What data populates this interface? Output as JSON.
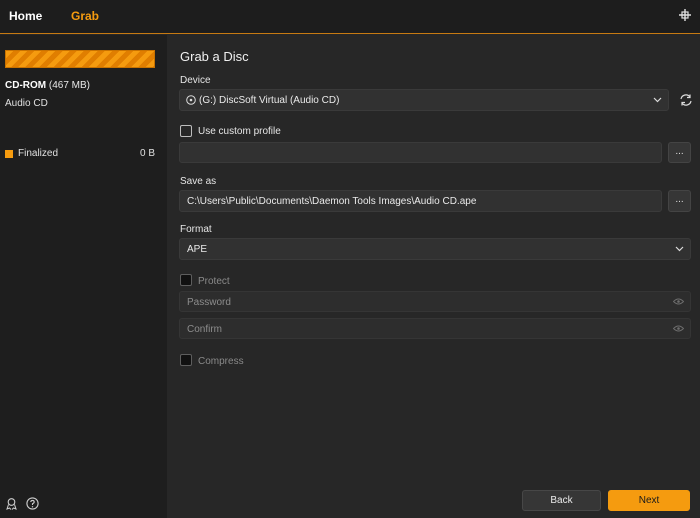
{
  "tabs": [
    {
      "label": "Home"
    },
    {
      "label": "Grab"
    }
  ],
  "sidebar": {
    "disc_name": "CD-ROM",
    "disc_size": "(467 MB)",
    "disc_type": "Audio CD",
    "status_label": "Finalized",
    "status_size": "0 B",
    "progress_fraction": 1.0
  },
  "main": {
    "title": "Grab a Disc",
    "device": {
      "label": "Device",
      "value": "(G:) DiscSoft Virtual (Audio CD)"
    },
    "custom_profile": {
      "label": "Use custom profile",
      "checked": false,
      "value": "",
      "browse_label": "..."
    },
    "save_as": {
      "label": "Save as",
      "value": "C:\\Users\\Public\\Documents\\Daemon Tools Images\\Audio CD.ape",
      "browse_label": "..."
    },
    "format": {
      "label": "Format",
      "value": "APE"
    },
    "protect": {
      "label": "Protect",
      "checked": false,
      "password_placeholder": "Password",
      "confirm_placeholder": "Confirm"
    },
    "compress": {
      "label": "Compress",
      "checked": false
    }
  },
  "footer": {
    "back_label": "Back",
    "next_label": "Next"
  },
  "colors": {
    "accent": "#f59b0f",
    "background": "#272727",
    "sidebar": "#1e1e1e",
    "field": "#313131"
  }
}
